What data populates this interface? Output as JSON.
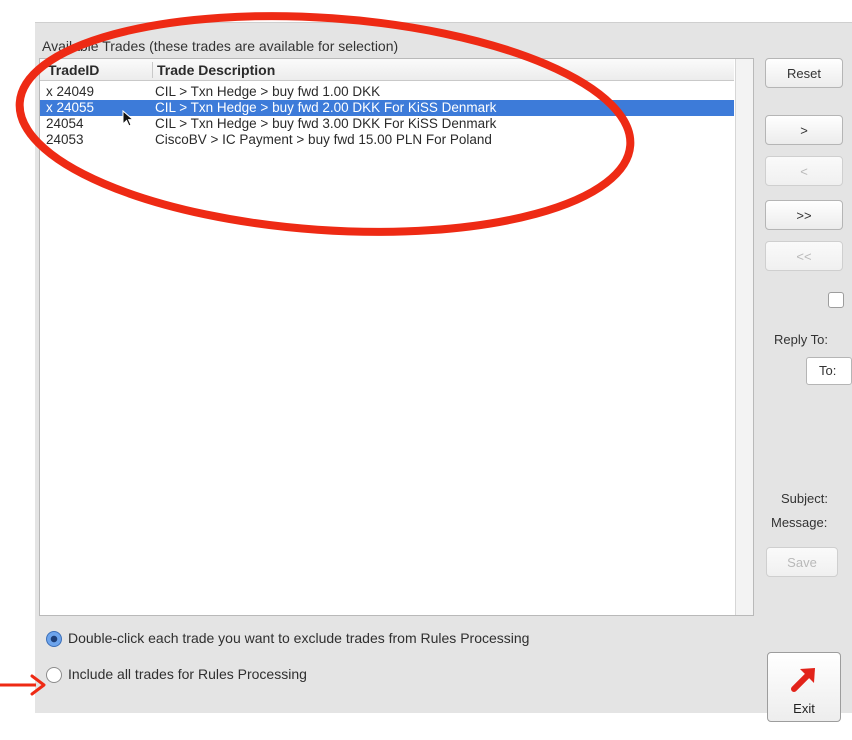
{
  "available_trades": {
    "section_label": "Available Trades (these trades are available for selection)",
    "columns": {
      "id": "TradeID",
      "description": "Trade Description"
    },
    "rows": [
      {
        "id": "x 24049",
        "description": "CIL  >  Txn Hedge  > buy fwd 1.00 DKK"
      },
      {
        "id": "x 24055",
        "description": "CIL  >  Txn Hedge  > buy fwd 2.00 DKK  For KiSS Denmark",
        "selected": true
      },
      {
        "id": "24054",
        "description": "CIL  >  Txn Hedge  > buy fwd 3.00 DKK  For KiSS Denmark"
      },
      {
        "id": "24053",
        "description": "CiscoBV  >  IC Payment  > buy fwd 15.00 PLN  For Poland"
      }
    ]
  },
  "side_panel": {
    "reset_label": "Reset",
    "move_right_label": ">",
    "move_left_label": "<",
    "move_all_right_label": ">>",
    "move_all_left_label": "<<",
    "reply_to_label": "Reply To:",
    "to_field_value": "To:",
    "subject_label": "Subject:",
    "message_label": "Message:",
    "save_label": "Save"
  },
  "options": {
    "exclude_label": "Double-click each trade you want to exclude trades from Rules Processing",
    "include_label": "Include all trades for Rules Processing",
    "selected": "exclude"
  },
  "exit": {
    "label": "Exit",
    "icon": "red-arrow-icon"
  },
  "colors": {
    "selection": "#3d7bd9",
    "annotation": "#ee2a14",
    "panel": "#e4e4e4"
  }
}
